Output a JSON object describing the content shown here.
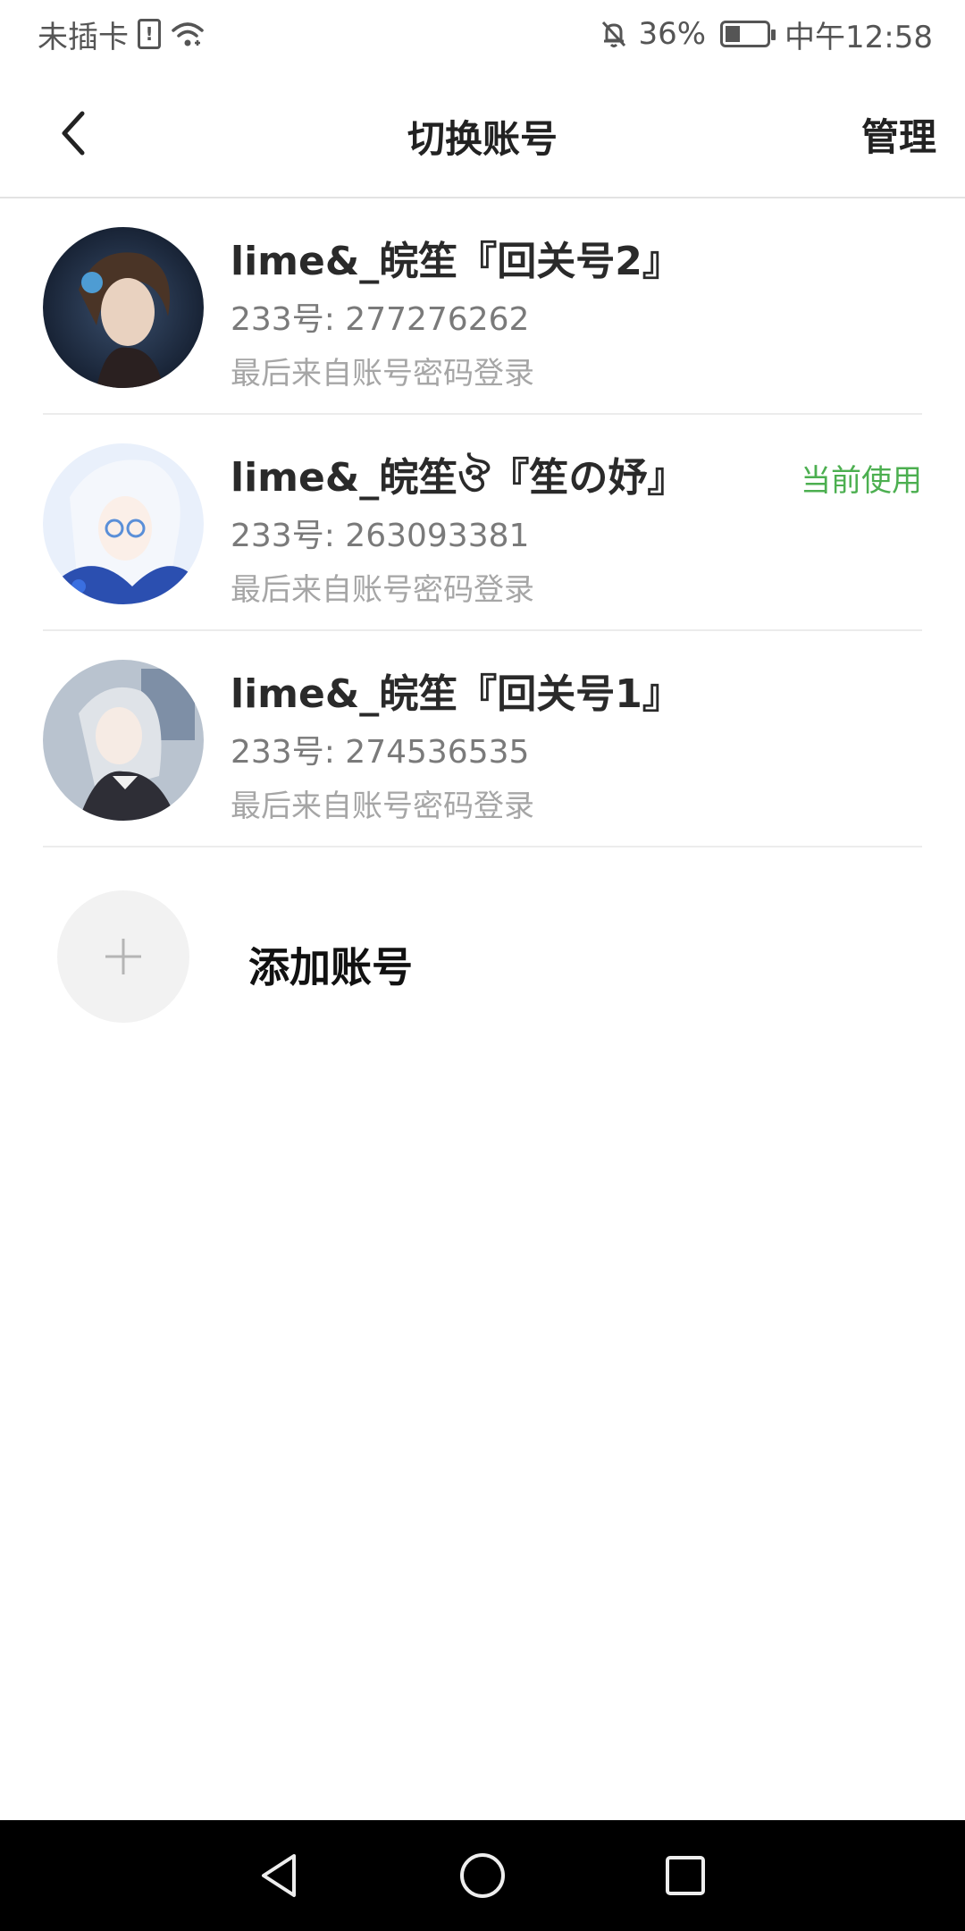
{
  "status_bar": {
    "carrier": "未插卡",
    "battery_percent": "36%",
    "time": "中午12:58",
    "battery_level": 0.36,
    "icons": [
      "sim-alert-icon",
      "wifi-icon",
      "bell-off-icon",
      "battery-icon"
    ]
  },
  "header": {
    "title": "切换账号",
    "manage_label": "管理",
    "back_icon": "back-arrow-icon"
  },
  "accounts": [
    {
      "name": "lime&_皖笙『回关号2』",
      "id_text": "233号: 277276262",
      "login_text": "最后来自账号密码登录",
      "status": ""
    },
    {
      "name": "lime&_皖笙ঔ『笙の妤』",
      "id_text": "233号: 263093381",
      "login_text": "最后来自账号密码登录",
      "status": "当前使用"
    },
    {
      "name": "lime&_皖笙『回关号1』",
      "id_text": "233号: 274536535",
      "login_text": "最后来自账号密码登录",
      "status": ""
    }
  ],
  "add_account": {
    "label": "添加账号",
    "icon": "plus-icon"
  },
  "colors": {
    "accent_green": "#4caf50",
    "title_text": "#222222",
    "secondary_text": "#7a7a7a",
    "tertiary_text": "#a6a6a6",
    "navbar_bg": "#000000"
  },
  "nav_bar": {
    "icons": [
      "nav-back-icon",
      "nav-home-icon",
      "nav-recents-icon"
    ]
  }
}
